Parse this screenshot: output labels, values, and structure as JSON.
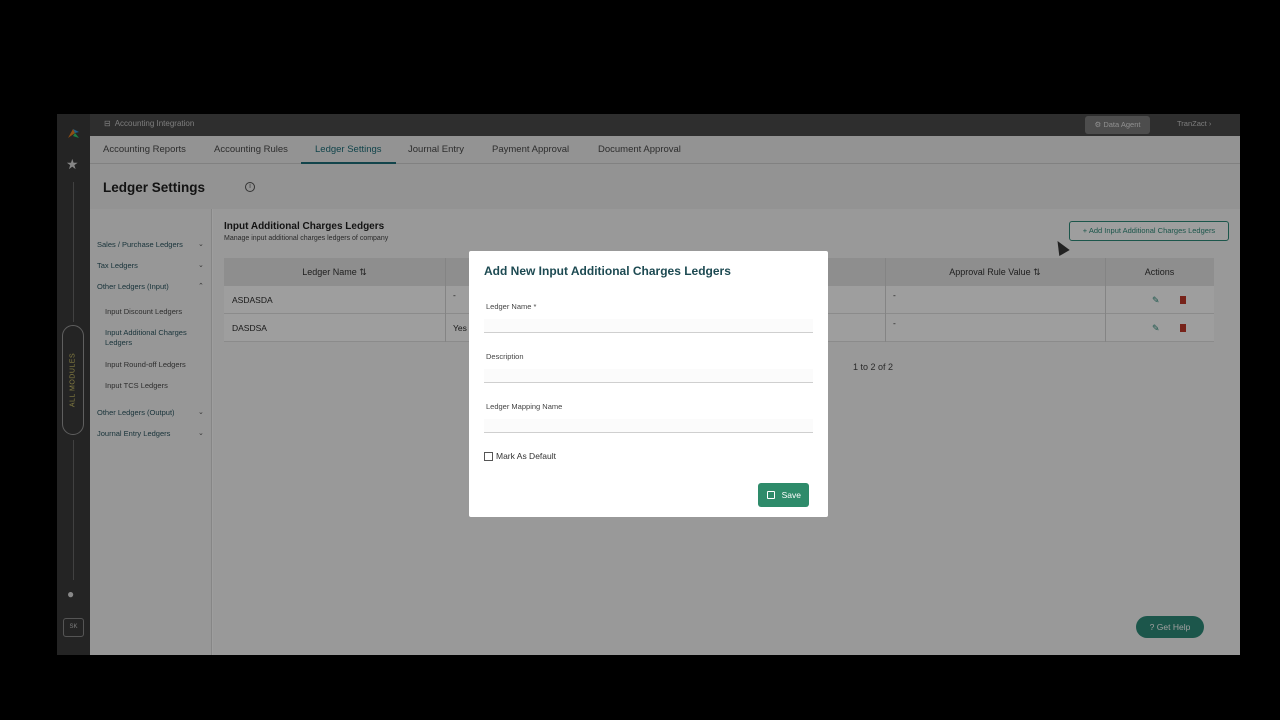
{
  "app": {
    "breadcrumb": "Accounting Integration",
    "data_agent": "Data Agent",
    "org": "TranZact",
    "rail_modules_label": "ALL MODULES",
    "user_initials": "SK"
  },
  "tabs": [
    "Accounting Reports",
    "Accounting Rules",
    "Ledger Settings",
    "Journal Entry",
    "Payment Approval",
    "Document Approval"
  ],
  "page_title": "Ledger Settings",
  "sidebar": {
    "groups": [
      {
        "label": "Sales / Purchase Ledgers"
      },
      {
        "label": "Tax Ledgers"
      },
      {
        "label": "Other Ledgers (Input)"
      },
      {
        "label": "Other Ledgers (Output)"
      },
      {
        "label": "Journal Entry Ledgers"
      }
    ],
    "subitems": [
      "Input Discount Ledgers",
      "Input Additional Charges Ledgers",
      "Input Round-off Ledgers",
      "Input TCS Ledgers"
    ]
  },
  "main": {
    "title": "Input Additional Charges Ledgers",
    "subtitle": "Manage input additional charges ledgers of company",
    "add_button": "+ Add Input Additional Charges Ledgers",
    "columns": {
      "ledger_name": "Ledger Name",
      "approval_rule_value": "Approval Rule Value",
      "actions": "Actions"
    },
    "rows": [
      {
        "name": "ASDASDA",
        "col2": "-",
        "approval": "-"
      },
      {
        "name": "DASDSA",
        "col2": "Yes",
        "approval": "-"
      }
    ],
    "pager": "1 to 2 of 2"
  },
  "help": "Get Help",
  "modal": {
    "title": "Add New Input Additional Charges Ledgers",
    "fields": {
      "ledger_name": "Ledger Name *",
      "description": "Description",
      "mapping": "Ledger Mapping Name"
    },
    "checkbox": "Mark As Default",
    "save": "Save",
    "close": "×"
  },
  "colors": {
    "accent": "#2e8b7a",
    "active_tab": "#1d6f7a"
  }
}
